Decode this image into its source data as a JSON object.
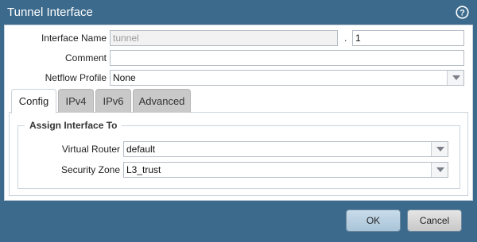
{
  "dialog": {
    "title": "Tunnel Interface"
  },
  "form": {
    "interface_name_label": "Interface Name",
    "interface_name_value": "tunnel",
    "separator": ".",
    "interface_suffix_value": "1",
    "comment_label": "Comment",
    "comment_value": "",
    "netflow_label": "Netflow Profile",
    "netflow_value": "None"
  },
  "tabs": [
    {
      "label": "Config",
      "active": true
    },
    {
      "label": "IPv4",
      "active": false
    },
    {
      "label": "IPv6",
      "active": false
    },
    {
      "label": "Advanced",
      "active": false
    }
  ],
  "config": {
    "section_title": "Assign Interface To",
    "virtual_router_label": "Virtual Router",
    "virtual_router_value": "default",
    "security_zone_label": "Security Zone",
    "security_zone_value": "L3_trust"
  },
  "footer": {
    "ok_label": "OK",
    "cancel_label": "Cancel"
  },
  "icons": {
    "help": "help-icon",
    "dropdown": "chevron-down-icon"
  }
}
